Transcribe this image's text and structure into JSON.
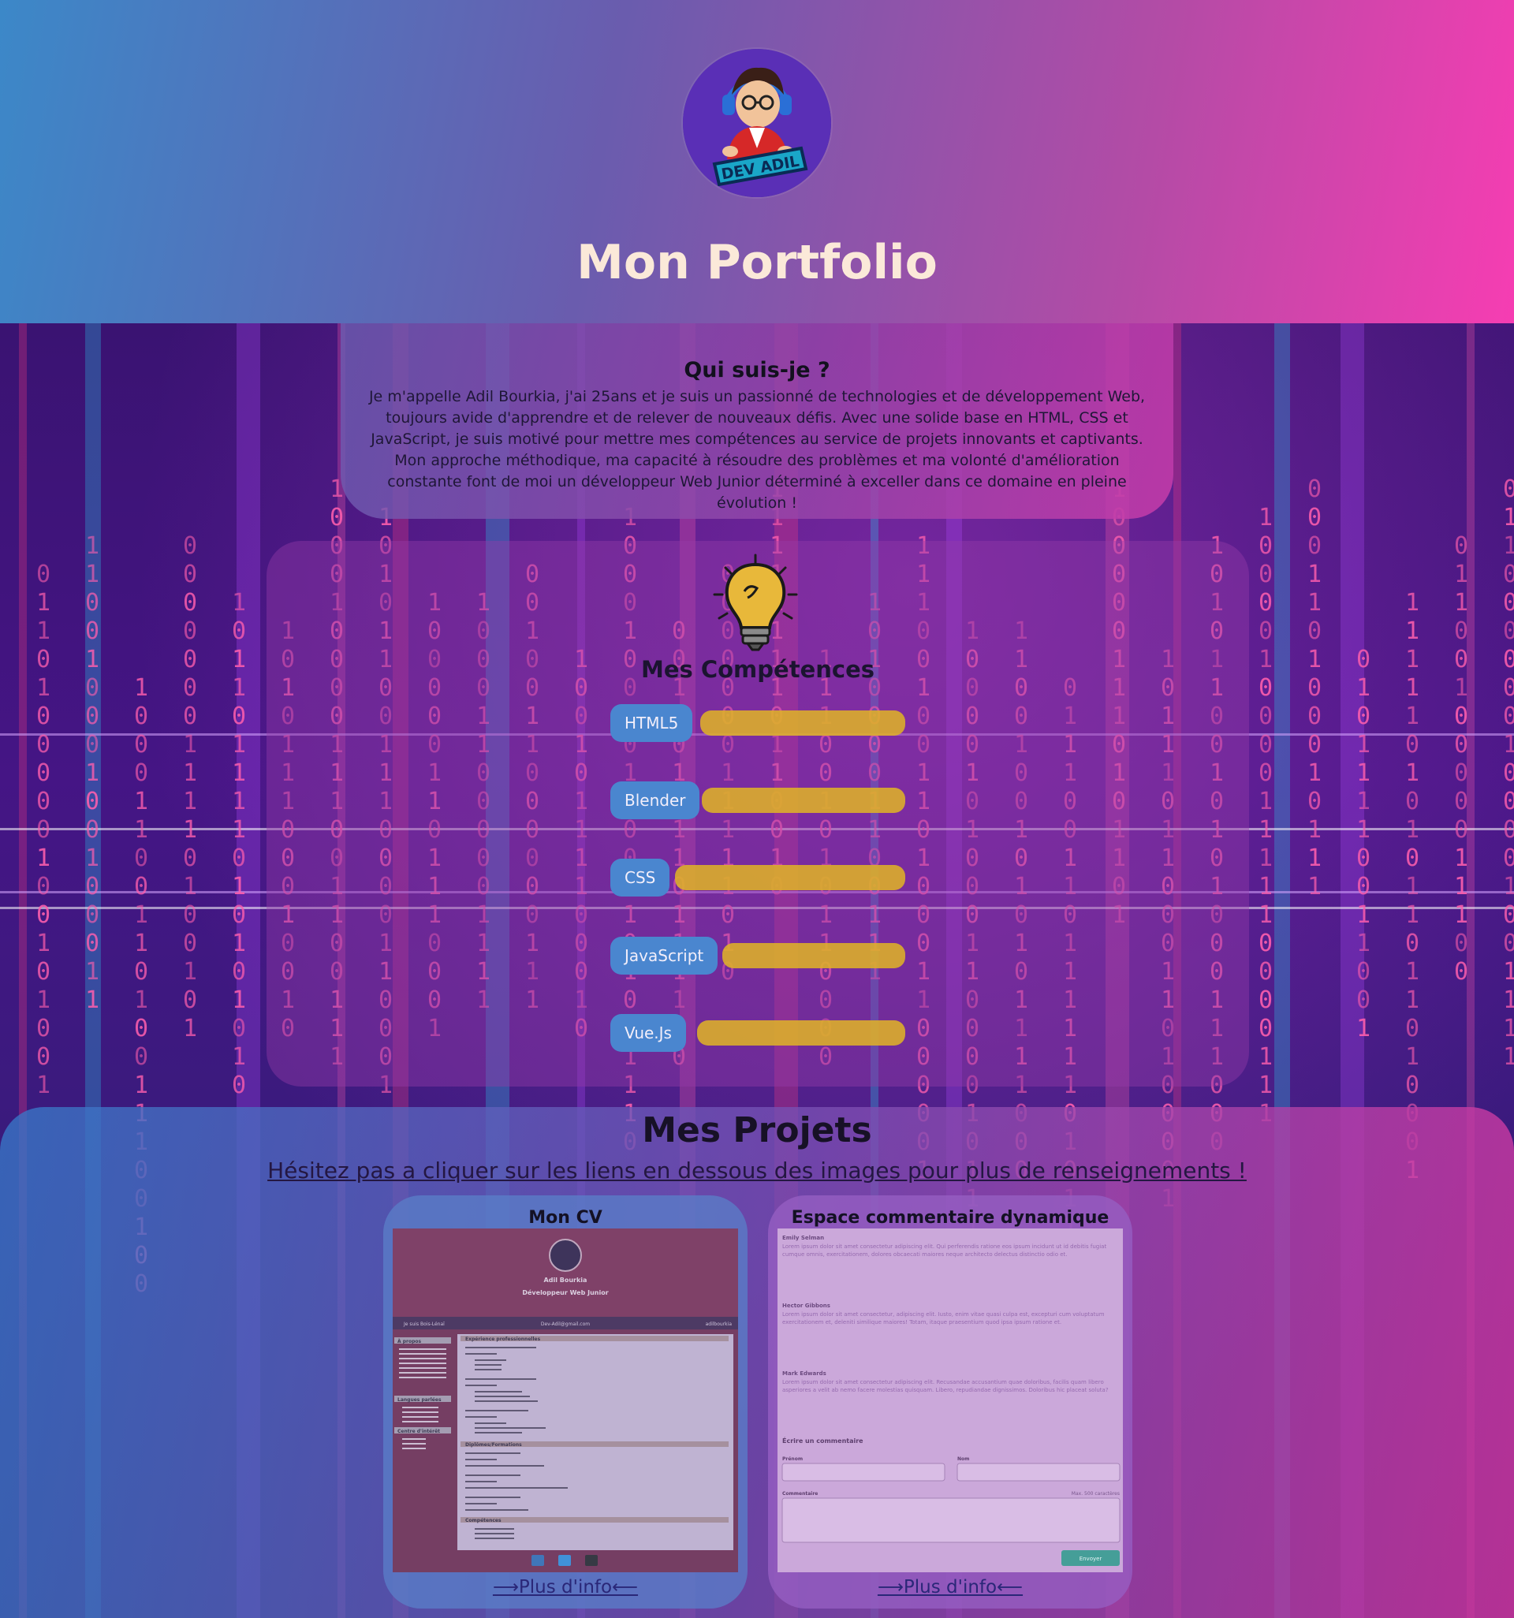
{
  "header": {
    "title": "Mon Portfolio",
    "avatar_label": "DEV ADIL"
  },
  "about": {
    "title": "Qui suis-je ?",
    "paragraph_1": "Je m'appelle Adil Bourkia, j'ai 25ans et je suis un passionné de technologies et de développement Web, toujours avide d'apprendre et de relever de nouveaux défis. Avec une solide base en HTML, CSS et JavaScript, je suis motivé pour mettre mes compétences au service de projets innovants et captivants.",
    "paragraph_2": "Mon approche méthodique, ma capacité à résoudre des problèmes et ma volonté d'amélioration constante font de moi un développeur Web Junior déterminé à exceller dans ce domaine en pleine évolution !"
  },
  "skills": {
    "title": "Mes Compétences",
    "icon": "lightbulb-icon",
    "items": [
      {
        "label": "HTML5"
      },
      {
        "label": "Blender"
      },
      {
        "label": "CSS"
      },
      {
        "label": "JavaScript"
      },
      {
        "label": "Vue.Js"
      }
    ]
  },
  "projects": {
    "title": "Mes Projets",
    "hint": "Hésitez pas a cliquer sur les liens en dessous des images pour plus de renseignements !",
    "cards": [
      {
        "title": "Mon CV",
        "link": "⟶Plus d'info⟵",
        "thumb": {
          "name": "Adil Bourkia",
          "role": "Développeur Web Junior",
          "contact_left": "Je suis Bois-Lénaï",
          "contact_mid": "Dev-Adil@gmail.com",
          "contact_right": "adilbourkia",
          "section_about": "À propos",
          "section_languages": "Langues parlées",
          "section_interests": "Centre d'intérêt",
          "section_experience": "Expérience professionnelles",
          "section_diplomas": "Diplômes/Formations",
          "section_skills": "Compétences"
        }
      },
      {
        "title": "Espace commentaire dynamique",
        "link": "⟶Plus d'info⟵",
        "thumb": {
          "comments": [
            {
              "author": "Emily Selman",
              "text": "Lorem ipsum dolor sit amet consectetur adipiscing elit. Qui perferendis ratione eos ipsum incidunt ut id debitis fugiat cumque omnis, exercitationem, dolores obcaecati maiores neque architecto delectus distinctio odio et."
            },
            {
              "author": "Hector Gibbons",
              "text": "Lorem ipsum dolor sit amet consectetur, adipiscing elit. Iusto, enim vitae quasi culpa est, excepturi cum voluptatum exercitationem et, deleniti similique maiores! Totam, itaque praesentium quod ipsa ipsum ratione et."
            },
            {
              "author": "Mark Edwards",
              "text": "Lorem ipsum dolor sit amet consectetur adipiscing elit. Recusandae accusantium quae doloribus, facilis quam libero asperiores a velit ab nemo facere molestias quisquam. Libero, repudiandae dignissimos. Doloribus hic placeat soluta?"
            }
          ],
          "form_title": "Écrire un commentaire",
          "first_name_label": "Prénom",
          "last_name_label": "Nom",
          "comment_label": "Commentaire",
          "max_chars": "Max. 500 caractères",
          "submit": "Envoyer"
        }
      }
    ]
  },
  "colors": {
    "header_gradient_start": "#3c88c8",
    "header_gradient_end": "#f63db2",
    "title_text": "#fbe9d9",
    "skill_chip": "#4a86cf",
    "skill_bar": "#deb028",
    "matrix_digits": "#ff5fae"
  }
}
